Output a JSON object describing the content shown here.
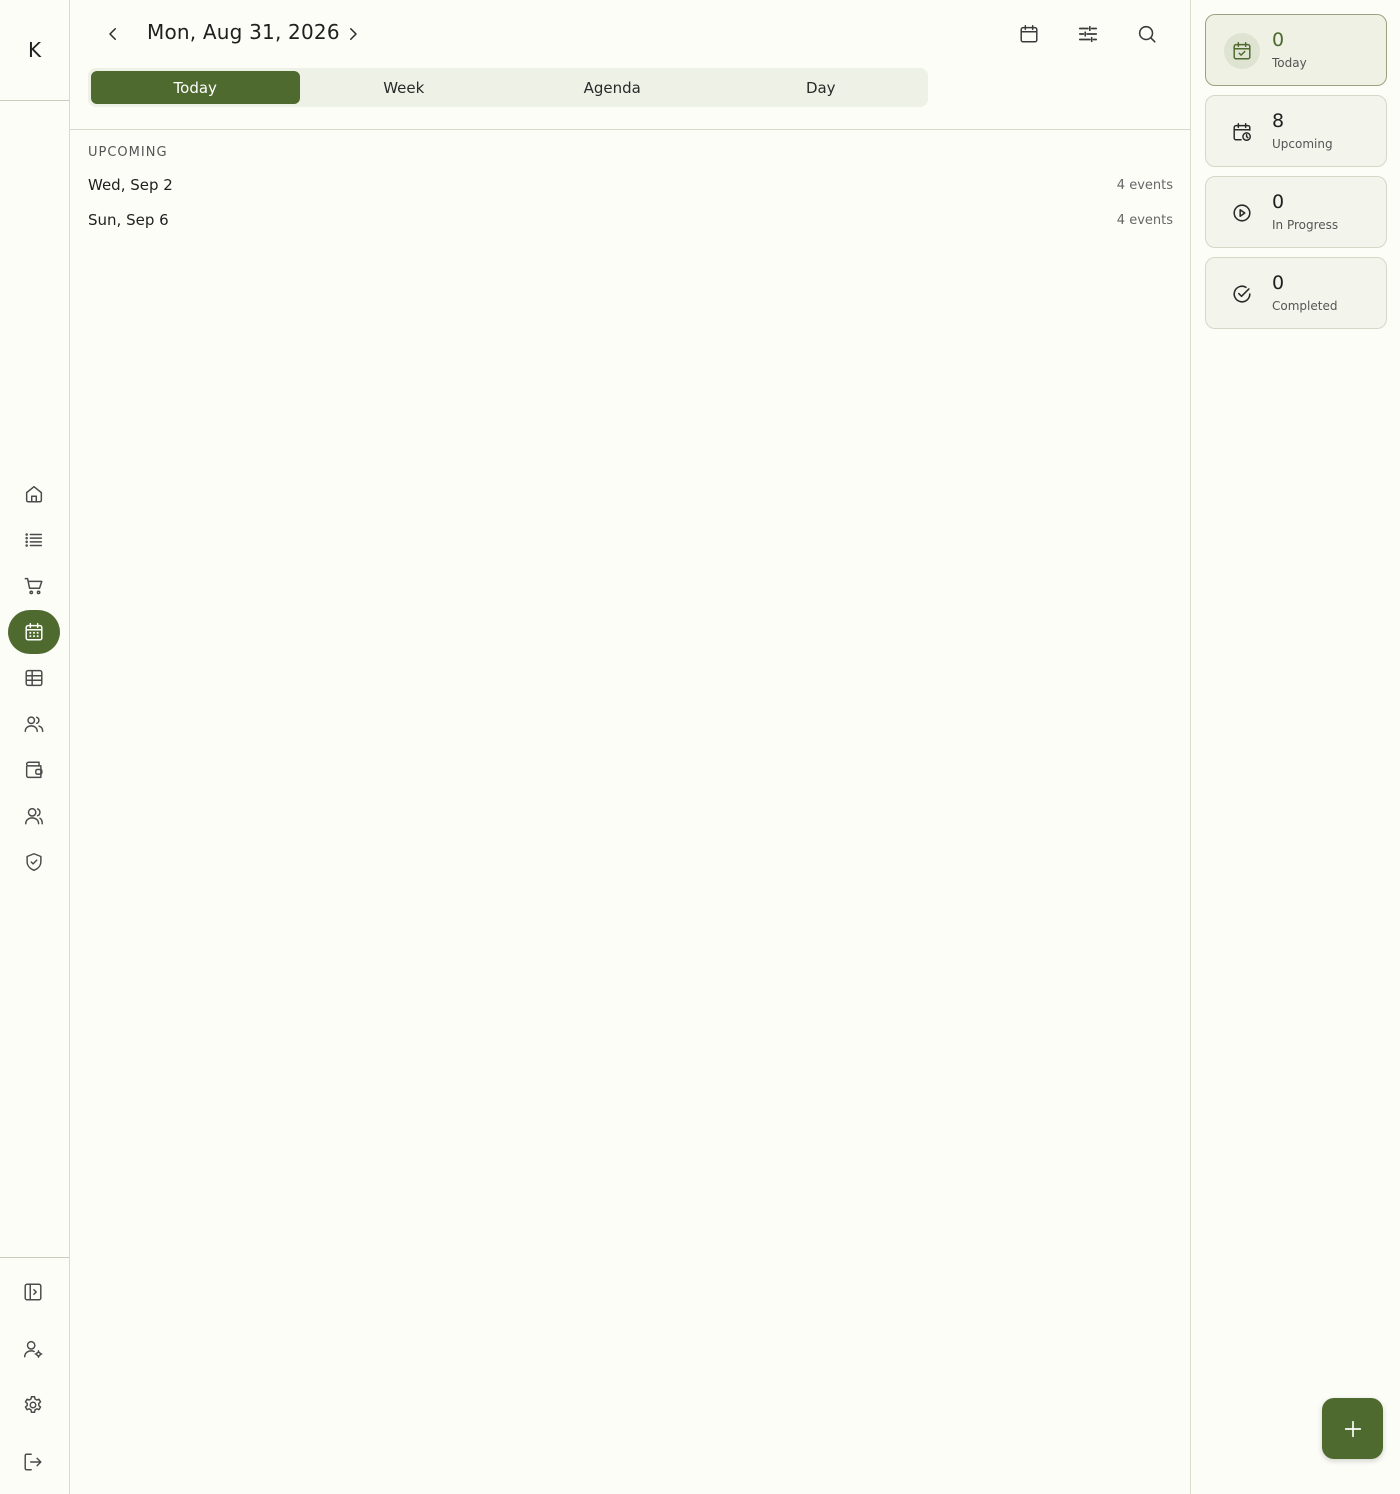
{
  "app": {
    "logo_text": "K"
  },
  "sidebar": {
    "items": [
      {
        "name": "home",
        "icon": "home-icon"
      },
      {
        "name": "list",
        "icon": "list-icon"
      },
      {
        "name": "cart",
        "icon": "cart-icon"
      },
      {
        "name": "calendar",
        "icon": "calendar-icon",
        "active": true
      },
      {
        "name": "table",
        "icon": "table-icon"
      },
      {
        "name": "contacts",
        "icon": "users-icon"
      },
      {
        "name": "wallet",
        "icon": "wallet-icon"
      },
      {
        "name": "team",
        "icon": "team-icon"
      },
      {
        "name": "security",
        "icon": "shield-check-icon"
      }
    ],
    "bottom_items": [
      {
        "name": "collapse",
        "icon": "sidebar-toggle-icon"
      },
      {
        "name": "account",
        "icon": "user-settings-icon"
      },
      {
        "name": "settings",
        "icon": "gear-icon"
      },
      {
        "name": "logout",
        "icon": "logout-icon"
      }
    ]
  },
  "header": {
    "date_title": "Mon, Aug 31, 2026",
    "tabs": [
      {
        "label": "Today",
        "active": true
      },
      {
        "label": "Week",
        "active": false
      },
      {
        "label": "Agenda",
        "active": false
      },
      {
        "label": "Day",
        "active": false
      }
    ]
  },
  "upcoming": {
    "section_label": "UPCOMING",
    "rows": [
      {
        "date": "Wed, Sep 2",
        "count": "4 events"
      },
      {
        "date": "Sun, Sep 6",
        "count": "4 events"
      }
    ]
  },
  "stats": [
    {
      "value": "0",
      "label": "Today",
      "icon": "calendar-check-icon",
      "active": true
    },
    {
      "value": "8",
      "label": "Upcoming",
      "icon": "calendar-clock-icon",
      "active": false
    },
    {
      "value": "0",
      "label": "In Progress",
      "icon": "play-circle-icon",
      "active": false
    },
    {
      "value": "0",
      "label": "Completed",
      "icon": "check-circle-icon",
      "active": false
    }
  ],
  "colors": {
    "accent": "#4e6a2e",
    "background": "#fdfdf8",
    "tab_track": "#eef1e6"
  }
}
